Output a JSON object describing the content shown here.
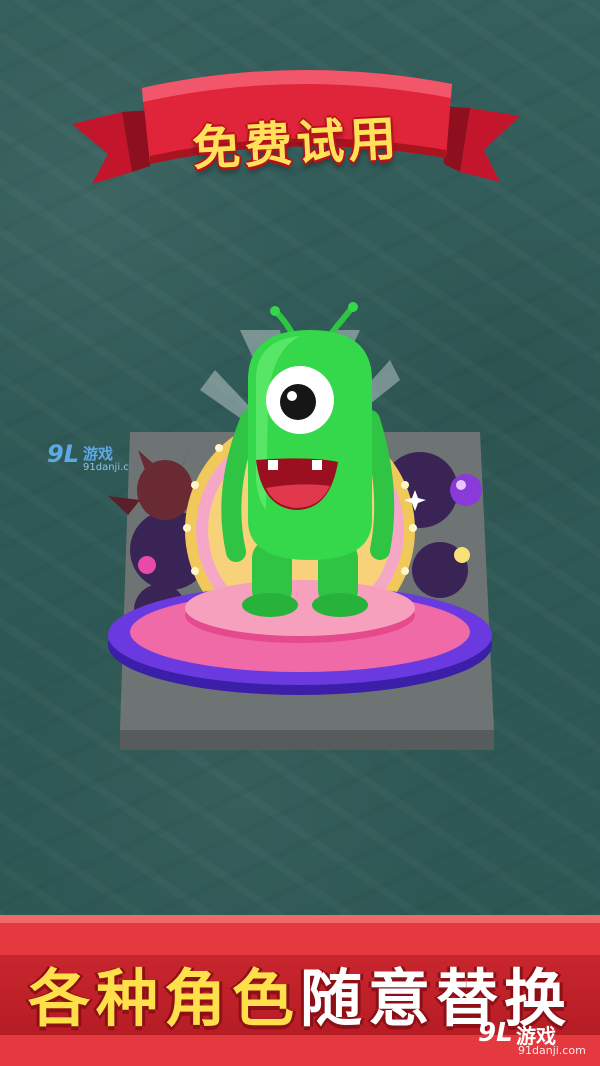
{
  "header": {
    "ribbon_title": "免费试用"
  },
  "banner": {
    "slogan_part1": "各种角色",
    "slogan_part2": "随意替换"
  },
  "watermark": {
    "logo_mark": "9L",
    "name": "游戏",
    "url": "91danji.com"
  },
  "colors": {
    "background": "#2f5a57",
    "ribbon_red": "#e0243a",
    "ribbon_text": "#ffe25a",
    "character_green": "#35d84b",
    "stage_purple": "#5a32c8",
    "banner_red": "#e43a3f"
  }
}
